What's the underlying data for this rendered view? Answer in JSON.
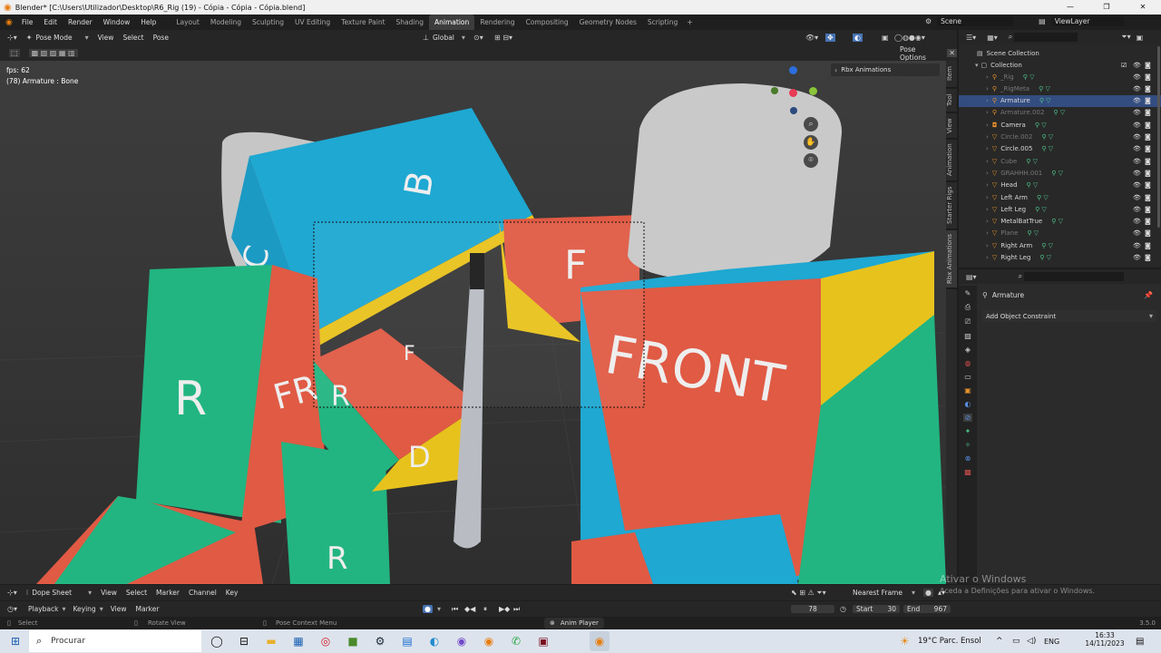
{
  "window": {
    "title": "Blender* [C:\\Users\\Utilizador\\Desktop\\R6_Rig (19) - Cópia - Cópia - Cópia.blend]"
  },
  "menu": [
    "File",
    "Edit",
    "Render",
    "Window",
    "Help"
  ],
  "workspaces": [
    "Layout",
    "Modeling",
    "Sculpting",
    "UV Editing",
    "Texture Paint",
    "Shading",
    "Animation",
    "Rendering",
    "Compositing",
    "Geometry Nodes",
    "Scripting"
  ],
  "active_workspace": "Animation",
  "scene_label": "Scene",
  "viewlayer_label": "ViewLayer",
  "viewport": {
    "mode": "Pose Mode",
    "menus": [
      "View",
      "Select",
      "Pose"
    ],
    "transform": "Global",
    "fps": "fps: 62",
    "object_info": "(78) Armature : Bone",
    "pose_options": "Pose Options",
    "rbx_panel": "Rbx Animations",
    "side_tabs": [
      "Item",
      "Tool",
      "View",
      "Animation",
      "Starter Rigs",
      "Rbx Animations"
    ],
    "cube_letters": {
      "b": "B",
      "c": "C",
      "r1": "R",
      "front1": "FRO",
      "r2": "R",
      "f1": "F",
      "d": "D",
      "f2": "F",
      "front2": "FRONT",
      "r3": "R"
    }
  },
  "outliner": {
    "scene_collection": "Scene Collection",
    "collection": "Collection",
    "items": [
      {
        "name": "_Rig",
        "dim": true
      },
      {
        "name": "_RigMeta",
        "dim": true
      },
      {
        "name": "Armature",
        "selected": true
      },
      {
        "name": "Armature.002",
        "dim": true
      },
      {
        "name": "Camera"
      },
      {
        "name": "Circle.002",
        "dim": true
      },
      {
        "name": "Circle.005"
      },
      {
        "name": "Cube",
        "dim": true
      },
      {
        "name": "GRAHHH.001",
        "dim": true
      },
      {
        "name": "Head"
      },
      {
        "name": "Left Arm"
      },
      {
        "name": "Left Leg"
      },
      {
        "name": "MetalBatTrue"
      },
      {
        "name": "Plane",
        "dim": true
      },
      {
        "name": "Right Arm"
      },
      {
        "name": "Right Leg"
      }
    ]
  },
  "properties": {
    "object": "Armature",
    "add_constraint": "Add Object Constraint"
  },
  "dopesheet": {
    "mode": "Dope Sheet",
    "menus": [
      "View",
      "Select",
      "Marker",
      "Channel",
      "Key"
    ],
    "snap": "Nearest Frame"
  },
  "timeline": {
    "menus": [
      "Playback",
      "Keying",
      "View",
      "Marker"
    ],
    "current_frame": "78",
    "start_label": "Start",
    "start": "30",
    "end_label": "End",
    "end": "967"
  },
  "status": {
    "select": "Select",
    "rotate": "Rotate View",
    "context": "Pose Context Menu",
    "anim_player": "Anim Player",
    "version": "3.5.0"
  },
  "watermark": {
    "line1": "Ativar o Windows",
    "line2": "Aceda a Definições para ativar o Windows."
  },
  "taskbar": {
    "search": "Procurar",
    "weather": "19°C  Parc. Ensol",
    "lang": "ENG",
    "time": "16:33",
    "date": "14/11/2023"
  }
}
